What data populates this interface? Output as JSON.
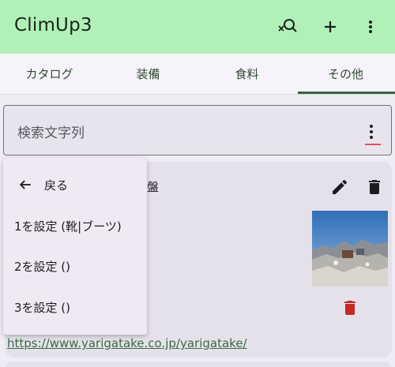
{
  "appbar": {
    "title": "ClimUp3",
    "icons": [
      "search-off-icon",
      "add-icon",
      "more-vert-icon"
    ]
  },
  "tabs": [
    {
      "label": "カタログ"
    },
    {
      "label": "装備"
    },
    {
      "label": "食料"
    },
    {
      "label": "その他",
      "active": true
    }
  ],
  "search": {
    "placeholder": "検索文字列"
  },
  "card": {
    "partial_title": "盤",
    "link": "https://www.yarigatake.co.jp/yarigatake/"
  },
  "menu": {
    "back_label": "戻る",
    "items": [
      {
        "label": "1を設定 (靴|ブーツ)"
      },
      {
        "label": "2を設定 ()"
      },
      {
        "label": "3を設定 ()"
      }
    ]
  },
  "colors": {
    "appbar": "#b1f1b7",
    "accent": "#33673b",
    "delete_red": "#c62828"
  }
}
